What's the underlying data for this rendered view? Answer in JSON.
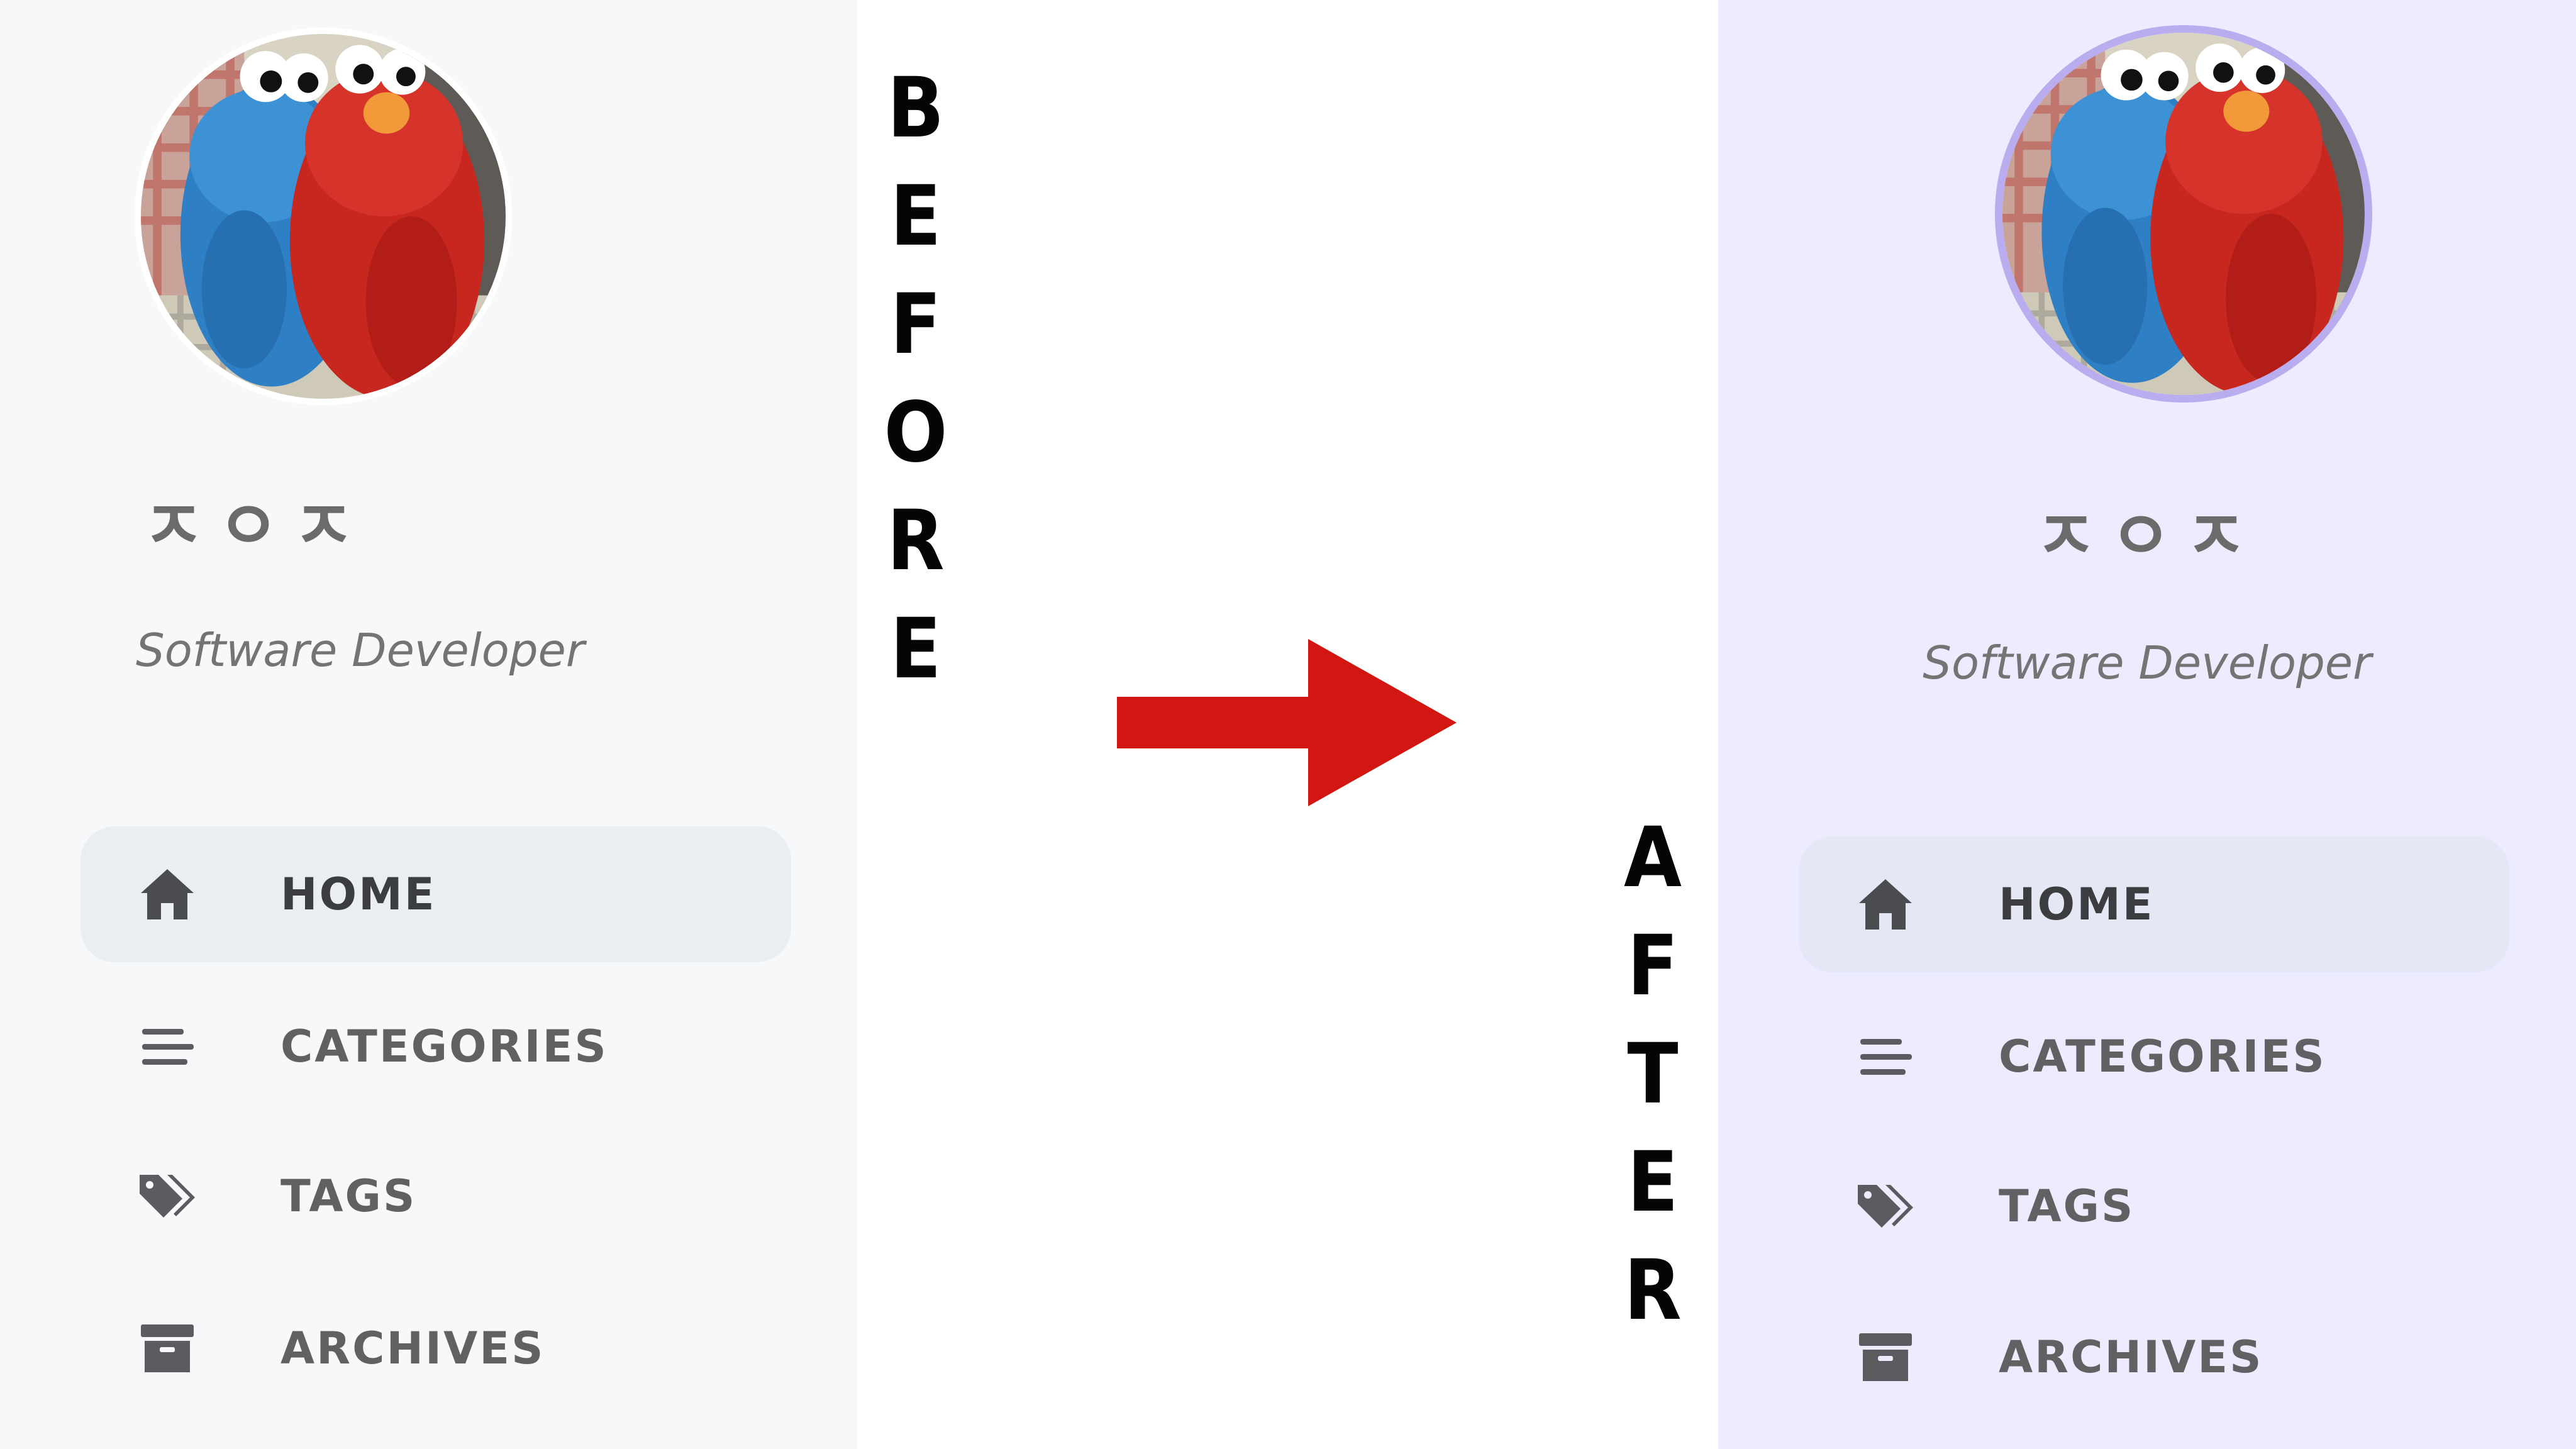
{
  "before_label": [
    "B",
    "E",
    "F",
    "O",
    "R",
    "E"
  ],
  "after_label": [
    "A",
    "F",
    "T",
    "E",
    "R"
  ],
  "arrow_color": "#d21611",
  "panels": [
    {
      "id": "before",
      "background": "#f6f8fa",
      "avatar_border_color": "#ffffff",
      "site_name": "ㅈㅇㅈ",
      "subtitle": "Software Developer",
      "nav": [
        {
          "label": "HOME",
          "icon": "home-icon",
          "active": true
        },
        {
          "label": "CATEGORIES",
          "icon": "stream-icon",
          "active": false
        },
        {
          "label": "TAGS",
          "icon": "tags-icon",
          "active": false
        },
        {
          "label": "ARCHIVES",
          "icon": "archive-icon",
          "active": false
        }
      ]
    },
    {
      "id": "after",
      "background": "#ecebff",
      "avatar_border_color": "#b9acef",
      "site_name": "ㅈㅇㅈ",
      "subtitle": "Software Developer",
      "nav": [
        {
          "label": "HOME",
          "icon": "home-icon",
          "active": true
        },
        {
          "label": "CATEGORIES",
          "icon": "stream-icon",
          "active": false
        },
        {
          "label": "TAGS",
          "icon": "tags-icon",
          "active": false
        },
        {
          "label": "ARCHIVES",
          "icon": "archive-icon",
          "active": false
        }
      ]
    }
  ]
}
